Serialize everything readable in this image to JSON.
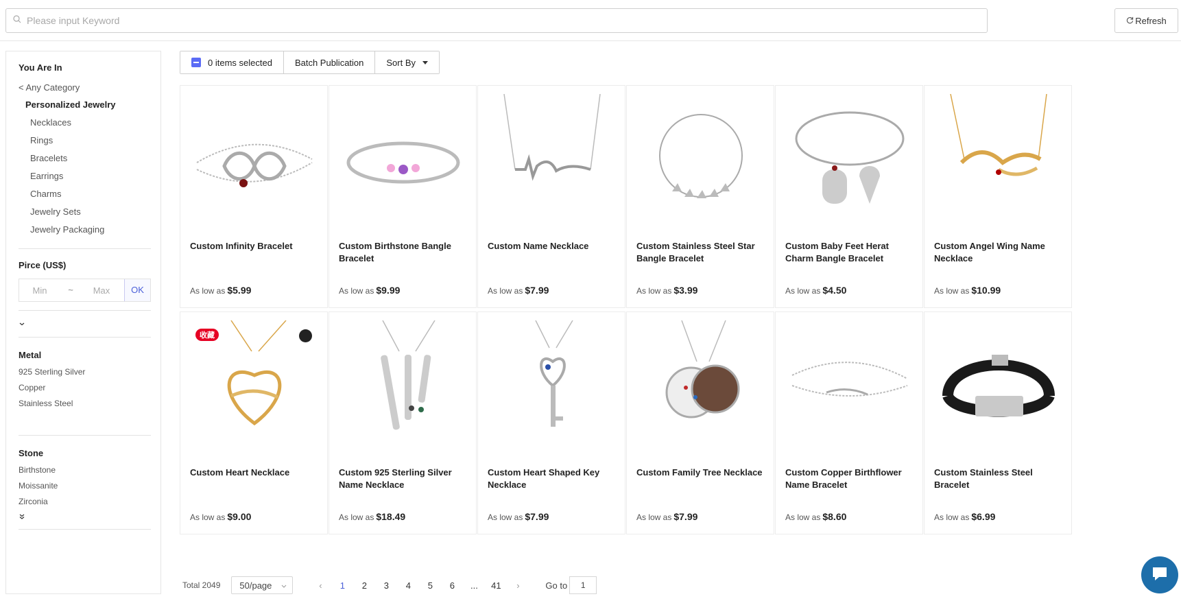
{
  "search": {
    "placeholder": "Please input Keyword"
  },
  "refresh_label": "Refresh",
  "sidebar": {
    "title": "You Are In",
    "any_category": "< Any Category",
    "root_category": "Personalized Jewelry",
    "categories": [
      "Necklaces",
      "Rings",
      "Bracelets",
      "Earrings",
      "Charms",
      "Jewelry Sets",
      "Jewelry Packaging"
    ],
    "price": {
      "title": "Pirce (US$)",
      "min_placeholder": "Min",
      "separator": "~",
      "max_placeholder": "Max",
      "ok_label": "OK"
    },
    "metal": {
      "title": "Metal",
      "items": [
        "925 Sterling Silver",
        "Copper",
        "Stainless Steel"
      ]
    },
    "stone": {
      "title": "Stone",
      "items": [
        "Birthstone",
        "Moissanite",
        "Zirconia"
      ]
    }
  },
  "toolbar": {
    "selected_label": "0 items selected",
    "batch_label": "Batch Publication",
    "sort_label": "Sort By"
  },
  "price_prefix": "As low as",
  "products": [
    {
      "title": "Custom Infinity Bracelet",
      "price": "$5.99",
      "image": "infinity-bracelet"
    },
    {
      "title": "Custom Birthstone Bangle Bracelet",
      "price": "$9.99",
      "image": "birthstone-bangle"
    },
    {
      "title": "Custom Name Necklace",
      "price": "$7.99",
      "image": "name-necklace"
    },
    {
      "title": "Custom Stainless Steel Star Bangle Bracelet",
      "price": "$3.99",
      "image": "star-bangle"
    },
    {
      "title": "Custom Baby Feet Herat Charm Bangle Bracelet",
      "price": "$4.50",
      "image": "baby-feet-bangle"
    },
    {
      "title": "Custom Angel Wing Name Necklace",
      "price": "$10.99",
      "image": "angel-wing-necklace"
    },
    {
      "title": "Custom Heart Necklace",
      "price": "$9.00",
      "image": "heart-necklace"
    },
    {
      "title": "Custom 925 Sterling Silver Name Necklace",
      "price": "$18.49",
      "image": "bar-name-necklace"
    },
    {
      "title": "Custom Heart Shaped Key Necklace",
      "price": "$7.99",
      "image": "key-necklace"
    },
    {
      "title": "Custom Family Tree Necklace",
      "price": "$7.99",
      "image": "family-tree-necklace"
    },
    {
      "title": "Custom Copper Birthflower Name Bracelet",
      "price": "$8.60",
      "image": "name-bracelet"
    },
    {
      "title": "Custom Stainless Steel Bracelet",
      "price": "$6.99",
      "image": "leather-bracelet"
    }
  ],
  "pin_badge": "收藏",
  "pagination": {
    "total": "Total 2049",
    "per_page": "50/page",
    "pages": [
      "1",
      "2",
      "3",
      "4",
      "5",
      "6",
      "...",
      "41"
    ],
    "current": "1",
    "goto_label": "Go to",
    "goto_value": "1"
  },
  "colors": {
    "accent": "#5b6bf5",
    "link": "#4a5fd8",
    "pinterest": "#e60023",
    "chat": "#1d6eaa"
  }
}
